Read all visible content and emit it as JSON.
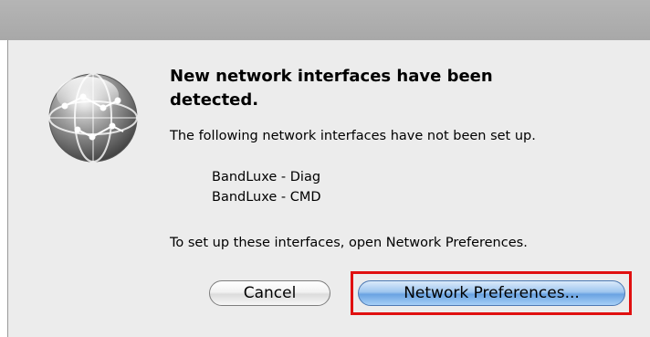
{
  "dialog": {
    "title": "New network interfaces have been detected.",
    "message": "The following network interfaces have not been set up.",
    "interfaces": [
      "BandLuxe - Diag",
      "BandLuxe - CMD"
    ],
    "instruction": "To set up these interfaces, open Network Preferences.",
    "icon": "network-globe-icon"
  },
  "buttons": {
    "cancel_label": "Cancel",
    "network_preferences_label": "Network Preferences...",
    "highlight_color": "#e01010"
  }
}
